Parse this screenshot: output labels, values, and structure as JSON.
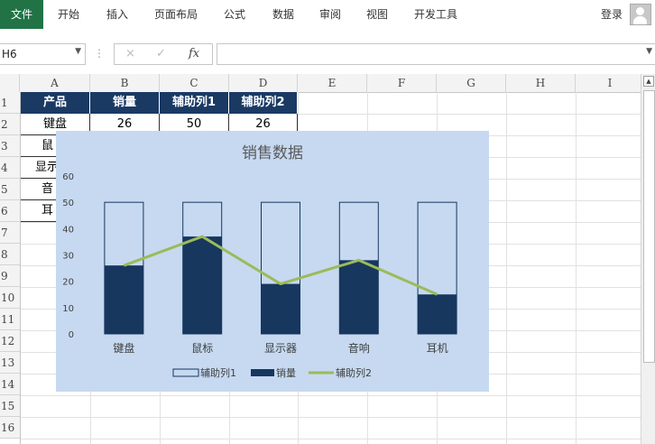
{
  "ribbon": {
    "tabs": [
      "文件",
      "开始",
      "插入",
      "页面布局",
      "公式",
      "数据",
      "审阅",
      "视图",
      "开发工具"
    ],
    "login": "登录"
  },
  "formula_bar": {
    "name_box": "H6",
    "cancel_icon": "×",
    "enter_icon": "✓",
    "func_icon": "fx",
    "formula": ""
  },
  "sheet": {
    "columns": [
      "A",
      "B",
      "C",
      "D",
      "E",
      "F",
      "G",
      "H",
      "I"
    ],
    "rows": [
      "1",
      "2",
      "3",
      "4",
      "5",
      "6",
      "7",
      "8",
      "9",
      "10",
      "11",
      "12",
      "13",
      "14",
      "15",
      "16"
    ],
    "header": [
      "产品",
      "销量",
      "辅助列1",
      "辅助列2"
    ],
    "visible_cells": {
      "a2": "键盘",
      "b2": "26",
      "c2": "50",
      "d2": "26",
      "a3": "鼠",
      "a4": "显示",
      "a5": "音",
      "a6": "耳"
    }
  },
  "chart_data": {
    "type": "bar",
    "title": "销售数据",
    "categories": [
      "键盘",
      "鼠标",
      "显示器",
      "音响",
      "耳机"
    ],
    "series": [
      {
        "name": "辅助列1",
        "type": "bar",
        "values": [
          50,
          50,
          50,
          50,
          50
        ],
        "style": "outline"
      },
      {
        "name": "销量",
        "type": "bar",
        "values": [
          26,
          37,
          19,
          28,
          15
        ],
        "style": "filled"
      },
      {
        "name": "辅助列2",
        "type": "line",
        "values": [
          26,
          37,
          19,
          28,
          15
        ]
      }
    ],
    "ylim": [
      0,
      60
    ],
    "yticks": [
      "0",
      "10",
      "20",
      "30",
      "40",
      "50",
      "60"
    ],
    "grid": false,
    "legend": "bottom",
    "colors": {
      "background": "#c6d9f1",
      "bar": "#17375e",
      "outline_fill": "#c6d9f1",
      "line": "#9bbb59",
      "title": "#595959",
      "text": "#404040"
    }
  },
  "colors": {
    "file_tab": "#217346",
    "table_header": "#1a3a64"
  }
}
